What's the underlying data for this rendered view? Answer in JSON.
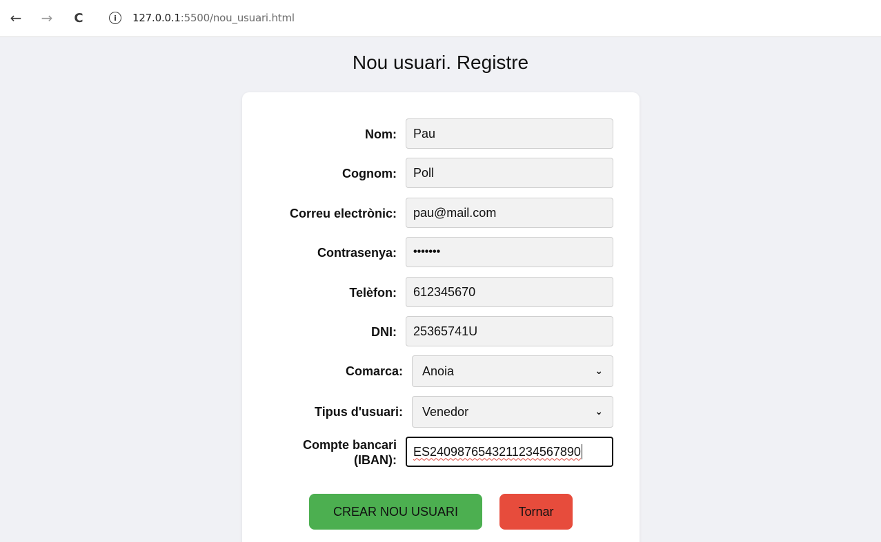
{
  "browser": {
    "url_host": "127.0.0.1",
    "url_rest": ":5500/nou_usuari.html"
  },
  "page": {
    "title": "Nou usuari. Registre"
  },
  "form": {
    "nom": {
      "label": "Nom:",
      "value": "Pau"
    },
    "cognom": {
      "label": "Cognom:",
      "value": "Poll"
    },
    "email": {
      "label": "Correu electrònic:",
      "value": "pau@mail.com"
    },
    "password": {
      "label": "Contrasenya:",
      "value": "•••••••"
    },
    "telefon": {
      "label": "Telèfon:",
      "value": "612345670"
    },
    "dni": {
      "label": "DNI:",
      "value": "25365741U"
    },
    "comarca": {
      "label": "Comarca:",
      "selected": "Anoia"
    },
    "tipus": {
      "label": "Tipus d'usuari:",
      "selected": "Venedor"
    },
    "iban": {
      "label_line1": "Compte bancari",
      "label_line2": "(IBAN):",
      "value": "ES2409876543211234567890"
    }
  },
  "buttons": {
    "create": "CREAR NOU USUARI",
    "back": "Tornar"
  },
  "colors": {
    "create_button": "#4caf50",
    "back_button": "#e74c3c",
    "page_background": "#f0f1f5"
  }
}
